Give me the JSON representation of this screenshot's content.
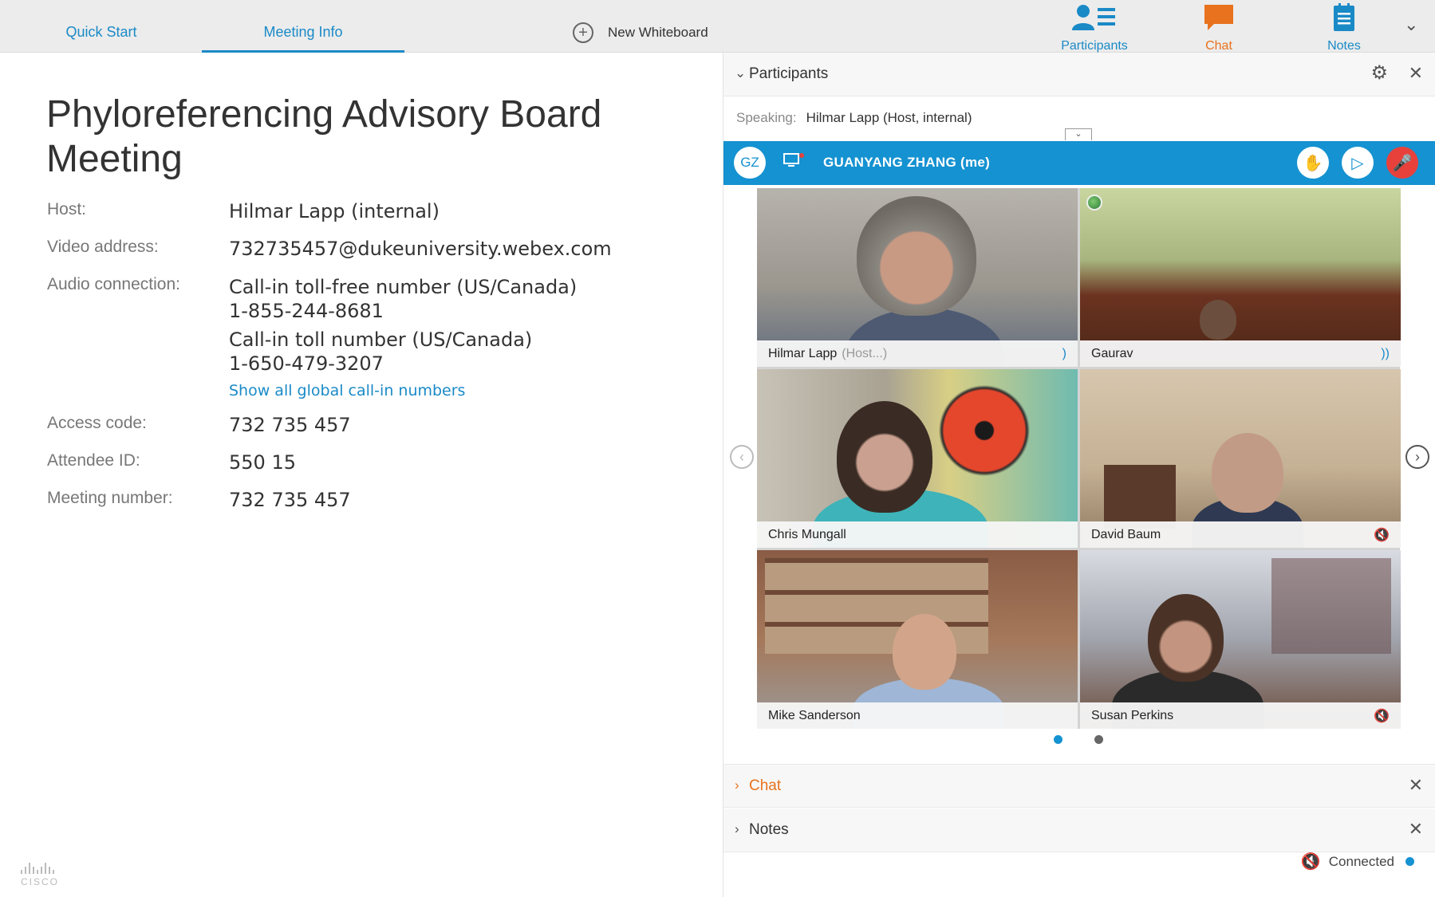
{
  "tabs": {
    "quick_start": "Quick Start",
    "meeting_info": "Meeting Info"
  },
  "new_whiteboard": "New Whiteboard",
  "toolbar": {
    "participants": "Participants",
    "chat": "Chat",
    "notes": "Notes"
  },
  "meeting": {
    "title": "Phyloreferencing Advisory Board Meeting",
    "host_label": "Host:",
    "host_value": "Hilmar Lapp (internal)",
    "video_label": "Video address:",
    "video_value": "732735457@dukeuniversity.webex.com",
    "audio_label": "Audio connection:",
    "tollfree_line": "Call-in toll-free number (US/Canada)",
    "tollfree_number": "1-855-244-8681",
    "toll_line": "Call-in toll number (US/Canada)",
    "toll_number": "1-650-479-3207",
    "show_all_link": "Show all global call-in numbers",
    "access_label": "Access code:",
    "access_value": "732 735 457",
    "attendee_label": "Attendee ID:",
    "attendee_value": "550 15",
    "meeting_number_label": "Meeting number:",
    "meeting_number_value": "732 735 457"
  },
  "brand": "CISCO",
  "participants_panel": {
    "title": "Participants",
    "speaking_label": "Speaking:",
    "speaking_value": "Hilmar Lapp (Host, internal)",
    "me_initials": "GZ",
    "me_name": "GUANYANG ZHANG (me)",
    "tiles": [
      {
        "name": "Hilmar Lapp",
        "sub": "(Host...)"
      },
      {
        "name": "Gaurav",
        "sub": ""
      },
      {
        "name": "Chris Mungall",
        "sub": ""
      },
      {
        "name": "David Baum",
        "sub": ""
      },
      {
        "name": "Mike Sanderson",
        "sub": ""
      },
      {
        "name": "Susan Perkins",
        "sub": ""
      }
    ]
  },
  "chat_panel": {
    "title": "Chat"
  },
  "notes_panel": {
    "title": "Notes"
  },
  "status": {
    "connection": "Connected"
  },
  "colors": {
    "accent": "#1592d1",
    "chat": "#e8721d",
    "mute": "#e8413b"
  }
}
